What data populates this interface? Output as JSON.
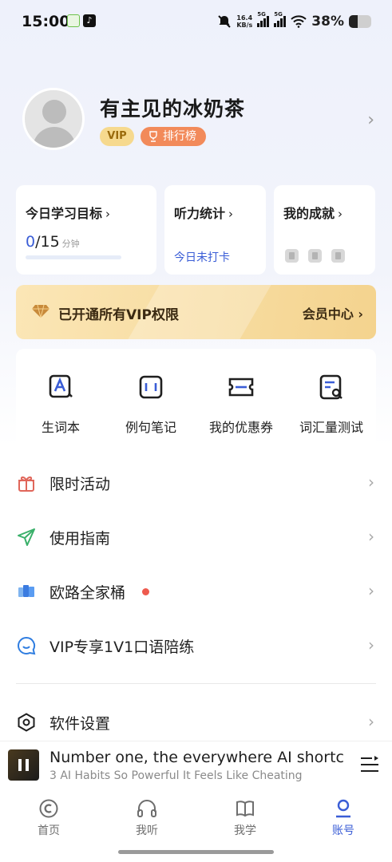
{
  "status_bar": {
    "time": "15:00",
    "net_speed_value": "16.4",
    "net_speed_unit": "KB/s",
    "signal_1_label": "5G",
    "signal_2_label": "5G",
    "battery_percent": "38%",
    "battery_level": 0.38
  },
  "profile": {
    "username": "有主见的冰奶茶",
    "vip_badge": "VIP",
    "rank_badge": "排行榜"
  },
  "cards": {
    "daily_goal": {
      "title": "今日学习目标",
      "current": "0",
      "total": "/15",
      "unit": "分钟",
      "progress": 0
    },
    "listening_stats": {
      "title": "听力统计",
      "status": "今日未打卡"
    },
    "achievements": {
      "title": "我的成就"
    }
  },
  "vip_banner": {
    "text": "已开通所有VIP权限",
    "link": "会员中心"
  },
  "tools": [
    {
      "label": "生词本",
      "icon": "vocabulary-book-icon"
    },
    {
      "label": "例句笔记",
      "icon": "sentence-notes-icon"
    },
    {
      "label": "我的优惠券",
      "icon": "coupon-icon"
    },
    {
      "label": "词汇量测试",
      "icon": "vocab-test-icon"
    }
  ],
  "menu": [
    {
      "label": "限时活动",
      "icon": "gift-icon"
    },
    {
      "label": "使用指南",
      "icon": "paper-plane-icon"
    },
    {
      "label": "欧路全家桶",
      "icon": "apps-bundle-icon"
    },
    {
      "label": "VIP专享1V1口语陪练",
      "icon": "chat-bubble-icon"
    },
    {
      "label": "软件设置",
      "icon": "settings-icon"
    }
  ],
  "player": {
    "title": "Number one, the everywhere AI shortcut",
    "subtitle": "3 AI Habits So Powerful It Feels Like Cheating"
  },
  "bottom_nav": [
    {
      "label": "首页",
      "icon": "home-icon"
    },
    {
      "label": "我听",
      "icon": "headphones-icon"
    },
    {
      "label": "我学",
      "icon": "book-icon"
    },
    {
      "label": "账号",
      "icon": "account-icon"
    }
  ],
  "colors": {
    "accent": "#3a5dd6",
    "vip_gold": "#f6d98e",
    "rank_orange": "#f28a5a",
    "dot_red": "#ee5a4e"
  }
}
